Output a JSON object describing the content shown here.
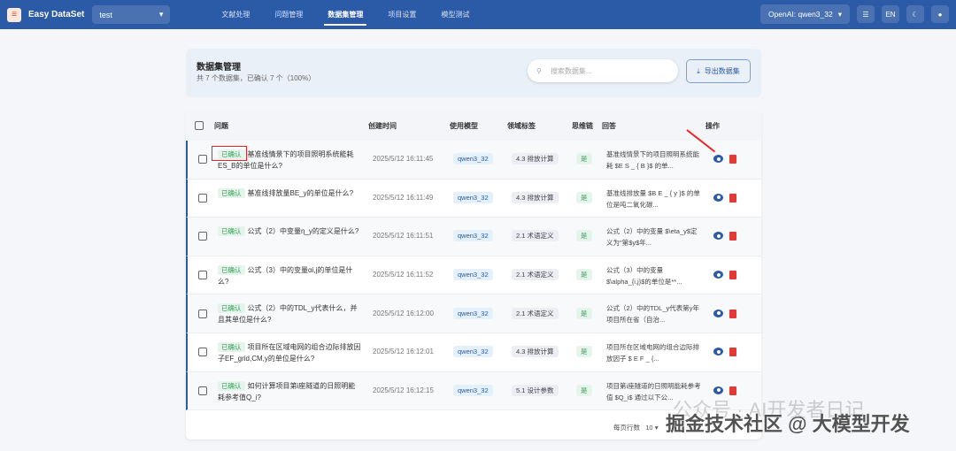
{
  "header": {
    "brand": "Easy DataSet",
    "project": "test",
    "nav": [
      "文献处理",
      "问题管理",
      "数据集管理",
      "项目设置",
      "模型测试"
    ],
    "active": 2,
    "model": "OpenAI: qwen3_32",
    "lang": "EN"
  },
  "summary": {
    "title": "数据集管理",
    "subtitle": "共 7 个数据集，已确认 7 个（100%）",
    "search_placeholder": "搜索数据集...",
    "export_label": "导出数据集"
  },
  "table": {
    "columns": [
      "问题",
      "创建时间",
      "使用模型",
      "领域标签",
      "思维链",
      "回答",
      "操作"
    ],
    "rows": [
      {
        "status": "已确认",
        "question": "基准线情景下的项目照明系统能耗ES_B的单位是什么?",
        "time": "2025/5/12 16:11:45",
        "model": "qwen3_32",
        "tag": "4.3 排放计算",
        "cot": "是",
        "answer": "基准线情景下的项目照明系统能耗 $E S _ { B }$ 的单..."
      },
      {
        "status": "已确认",
        "question": "基准线排放量BE_y的单位是什么?",
        "time": "2025/5/12 16:11:49",
        "model": "qwen3_32",
        "tag": "4.3 排放计算",
        "cot": "是",
        "answer": "基准线排放量 $B E _ { y }$ 的单位是吨二氧化碳..."
      },
      {
        "status": "已确认",
        "question": "公式（2）中变量η_y的定义是什么?",
        "time": "2025/5/12 16:11:51",
        "model": "qwen3_32",
        "tag": "2.1 术语定义",
        "cot": "是",
        "answer": "公式（2）中的变量 $\\eta_y$定义为\"第$y$年..."
      },
      {
        "status": "已确认",
        "question": "公式（3）中的变量αi,j的单位是什么?",
        "time": "2025/5/12 16:11:52",
        "model": "qwen3_32",
        "tag": "2.1 术语定义",
        "cot": "是",
        "answer": "公式（3）中的变量 $\\alpha_{i,j}$的单位是**..."
      },
      {
        "status": "已确认",
        "question": "公式（2）中的TDL_y代表什么，并且其单位是什么?",
        "time": "2025/5/12 16:12:00",
        "model": "qwen3_32",
        "tag": "2.1 术语定义",
        "cot": "是",
        "answer": "公式（2）中的TDL_y代表第y年项目所在省（自治..."
      },
      {
        "status": "已确认",
        "question": "项目所在区域电网的组合边际排放因子EF_grid,CM,y的单位是什么?",
        "time": "2025/5/12 16:12:01",
        "model": "qwen3_32",
        "tag": "4.3 排放计算",
        "cot": "是",
        "answer": "项目所在区域电网的组合边际排放因子 $ E F _ {..."
      },
      {
        "status": "已确认",
        "question": "如何计算项目第i座隧道的日照明能耗参考值Q_i?",
        "time": "2025/5/12 16:12:15",
        "model": "qwen3_32",
        "tag": "5.1 设计参数",
        "cot": "是",
        "answer": "项目第i座隧道的日照明能耗参考值 $Q_i$ 通过以下公..."
      }
    ],
    "rows_per_page_label": "每页行数",
    "rows_per_page": "10"
  },
  "watermark": "掘金技术社区 @ 大模型开发",
  "watermark2": "公众号 · AI开发者日记"
}
